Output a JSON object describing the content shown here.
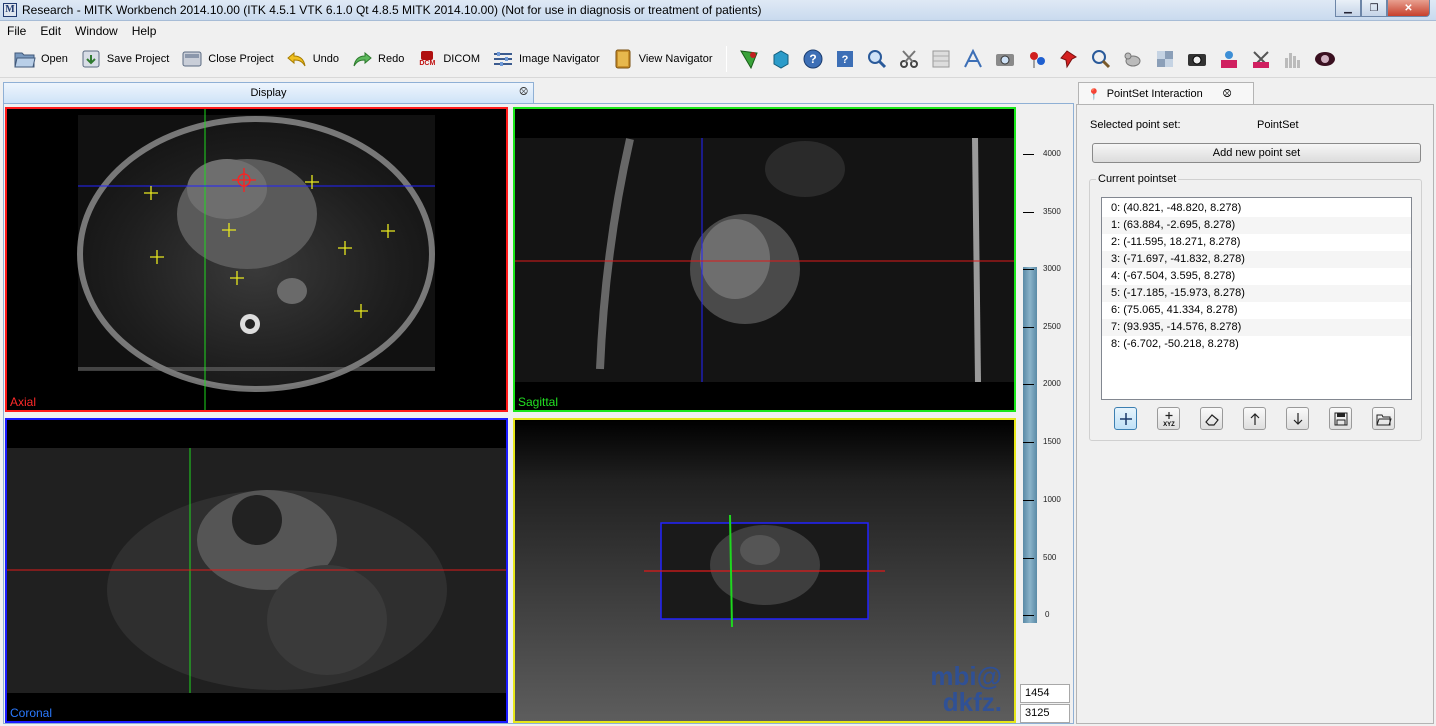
{
  "window": {
    "title": "Research - MITK Workbench 2014.10.00 (ITK 4.5.1  VTK 6.1.0 Qt 4.8.5 MITK 2014.10.00) (Not for use in diagnosis or treatment of patients)",
    "app_icon_letter": "M"
  },
  "menu": [
    "File",
    "Edit",
    "Window",
    "Help"
  ],
  "toolbar": {
    "open": "Open",
    "save_project": "Save Project",
    "close_project": "Close Project",
    "undo": "Undo",
    "redo": "Redo",
    "dicom": "DICOM",
    "dicom_badge": "DCM",
    "image_navigator": "Image Navigator",
    "view_navigator": "View Navigator"
  },
  "display": {
    "tab_label": "Display",
    "views": {
      "axial": "Axial",
      "sagittal": "Sagittal",
      "coronal": "Coronal"
    },
    "watermark": [
      "mbi@",
      "dkfz."
    ]
  },
  "level_window": {
    "scale_labels": [
      "4000",
      "3500",
      "3000",
      "2500",
      "2000",
      "1500",
      "1000",
      "500",
      "0"
    ],
    "level": "1454",
    "window": "3125"
  },
  "pointset_panel": {
    "tab_label": "PointSet Interaction",
    "selected_label": "Selected point set:",
    "selected_value": "PointSet",
    "add_button": "Add new point set",
    "group_title": "Current pointset",
    "points": [
      "0: (40.821, -48.820, 8.278)",
      "1: (63.884, -2.695, 8.278)",
      "2: (-11.595, 18.271, 8.278)",
      "3: (-71.697, -41.832, 8.278)",
      "4: (-67.504, 3.595, 8.278)",
      "5: (-17.185, -15.973, 8.278)",
      "6: (75.065, 41.334, 8.278)",
      "7: (93.935, -14.576, 8.278)",
      "8: (-6.702, -50.218, 8.278)"
    ]
  },
  "colors": {
    "axial_border": "#ff1a1a",
    "sagittal_border": "#1ae61a",
    "coronal_border": "#1a1aff",
    "threed_border": "#e6e61a",
    "watermark": "#2a50a0"
  }
}
